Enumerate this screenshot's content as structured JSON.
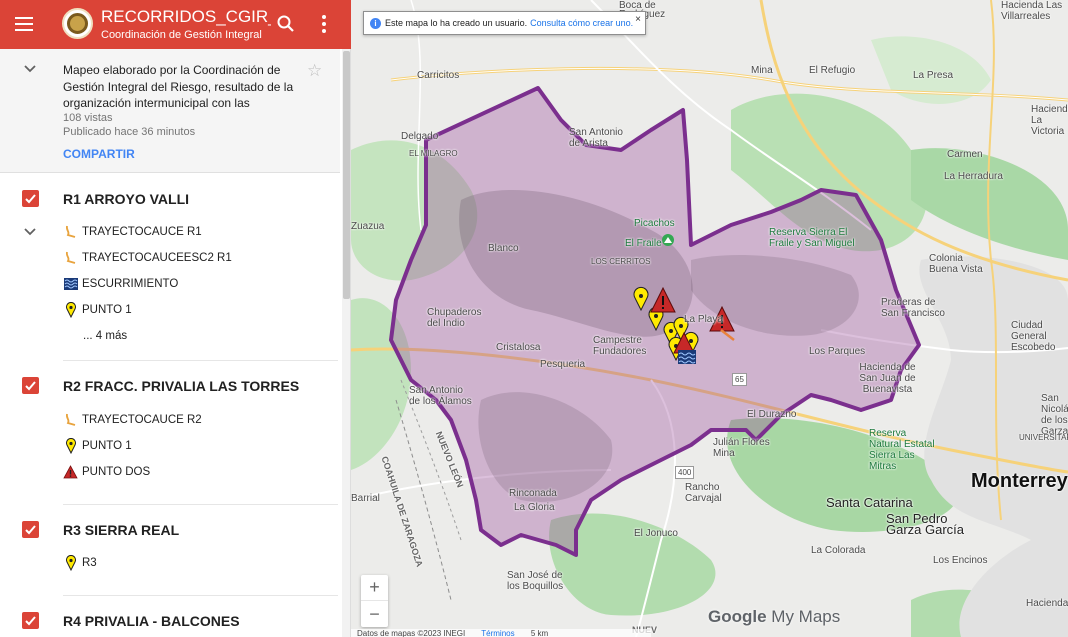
{
  "header": {
    "title": "RECORRIDOS_CGIR_0…",
    "subtitle": "Coordinación de Gestión Integral",
    "menu_icon": "menu-icon",
    "search_icon": "search-icon",
    "more_icon": "more-vert-icon",
    "color": "#db4437"
  },
  "info": {
    "description": "Mapeo elaborado por la Coordinación de Gestión Integral del Riesgo, resultado de la organización intermunicipal con las",
    "views": "108 vistas",
    "published": "Publicado hace 36 minutos",
    "share_label": "COMPARTIR",
    "star": "☆"
  },
  "layers": [
    {
      "title": "R1 ARROYO VALLI",
      "items": [
        {
          "icon": "route-icon",
          "label": "TRAYECTOCAUCE R1"
        },
        {
          "icon": "route-icon",
          "label": "TRAYECTOCAUCEESC2 R1"
        },
        {
          "icon": "water-icon",
          "label": "ESCURRIMIENTO"
        },
        {
          "icon": "pin-icon",
          "label": "PUNTO 1"
        }
      ],
      "more": "... 4 más"
    },
    {
      "title": "R2 FRACC. PRIVALIA LAS TORRES",
      "items": [
        {
          "icon": "route-icon",
          "label": "TRAYECTOCAUCE R2"
        },
        {
          "icon": "pin-icon",
          "label": "PUNTO 1"
        },
        {
          "icon": "warning-icon",
          "label": "PUNTO DOS"
        }
      ]
    },
    {
      "title": "R3 SIERRA REAL",
      "items": [
        {
          "icon": "pin-icon",
          "label": "R3"
        }
      ]
    },
    {
      "title": "R4 PRIVALIA - BALCONES",
      "items": []
    }
  ],
  "map": {
    "notice_text": "Este mapa lo ha creado un usuario.",
    "notice_link": "Consulta cómo crear uno.",
    "notice_close": "×",
    "zoom_in": "+",
    "zoom_out": "−",
    "attribution": "Datos de mapas ©2023 INEGI",
    "terms": "Términos",
    "scale": "5 km",
    "brand_google": "Google",
    "brand_mymaps": "My Maps",
    "polygon_color": "#7b2f8e",
    "places": {
      "boca": "Boca de",
      "rodriguez": "Rodríguez",
      "hacienda_villarreales": "Hacienda Las Villarreales",
      "hacienda_victoria": "Hacienda La Victoria",
      "carricitos": "Carricitos",
      "mina": "Mina",
      "el_refugio": "El Refugio",
      "la_presa": "La Presa",
      "delgado": "Delgado",
      "san_antonio": "San Antonio de Arista",
      "el_milagro": "EL MILAGRO",
      "carmen": "Carmen",
      "la_herradura": "La Herradura",
      "zuazua": "Zuazua",
      "blanco": "Blanco",
      "picachos": "Picachos",
      "el_fraile": "El Fraile",
      "reserva_fraile": "Reserva Sierra El Fraile y San Miguel",
      "los_cerritos": "LOS CERRITOS",
      "colonia_buena_vista": "Colonia Buena Vista",
      "chupaderos": "Chupaderos del Indio",
      "praderas": "Praderas de San Francisco",
      "ciudad_escobedo": "Ciudad General Escobedo",
      "la_playa": "La Playa",
      "cristalosa": "Cristalosa",
      "campestre": "Campestre Fundadores",
      "los_parques": "Los Parques",
      "pesqueria": "Pesqueria",
      "hacienda_sjb": "Hacienda de San Juan de Buenavista",
      "san_antonio_alamos": "San Antonio de los Álamos",
      "san_nicolas": "San Nicolás de los Garza",
      "el_durazno": "El Durazno",
      "coahuila": "COAHUILA DE ZARAGOZA",
      "nuevo_leon": "NUEVO LEÓN",
      "julian_flores": "Julián Flores Mina",
      "reserva_mitras": "Reserva Natural Estatal Sierra Las Mitras",
      "universitaria": "UNIVERSITARIA",
      "monterrey": "Monterrey",
      "barrial": "Barrial",
      "rancho_carvajal": "Rancho Carvajal",
      "santa_catarina": "Santa Catarina",
      "san_pedro": "San Pedro Garza García",
      "rinconada": "Rinconada",
      "la_gloria": "La Gloria",
      "el_jonuco": "El Jonuco",
      "la_colorada": "La Colorada",
      "san_jose": "San José de los Boquillos",
      "los_encinos": "Los Encinos",
      "hacienda_sta": "Hacienda Sta",
      "road_400": "400",
      "road_65": "65",
      "nuevo": "NUEV"
    }
  }
}
